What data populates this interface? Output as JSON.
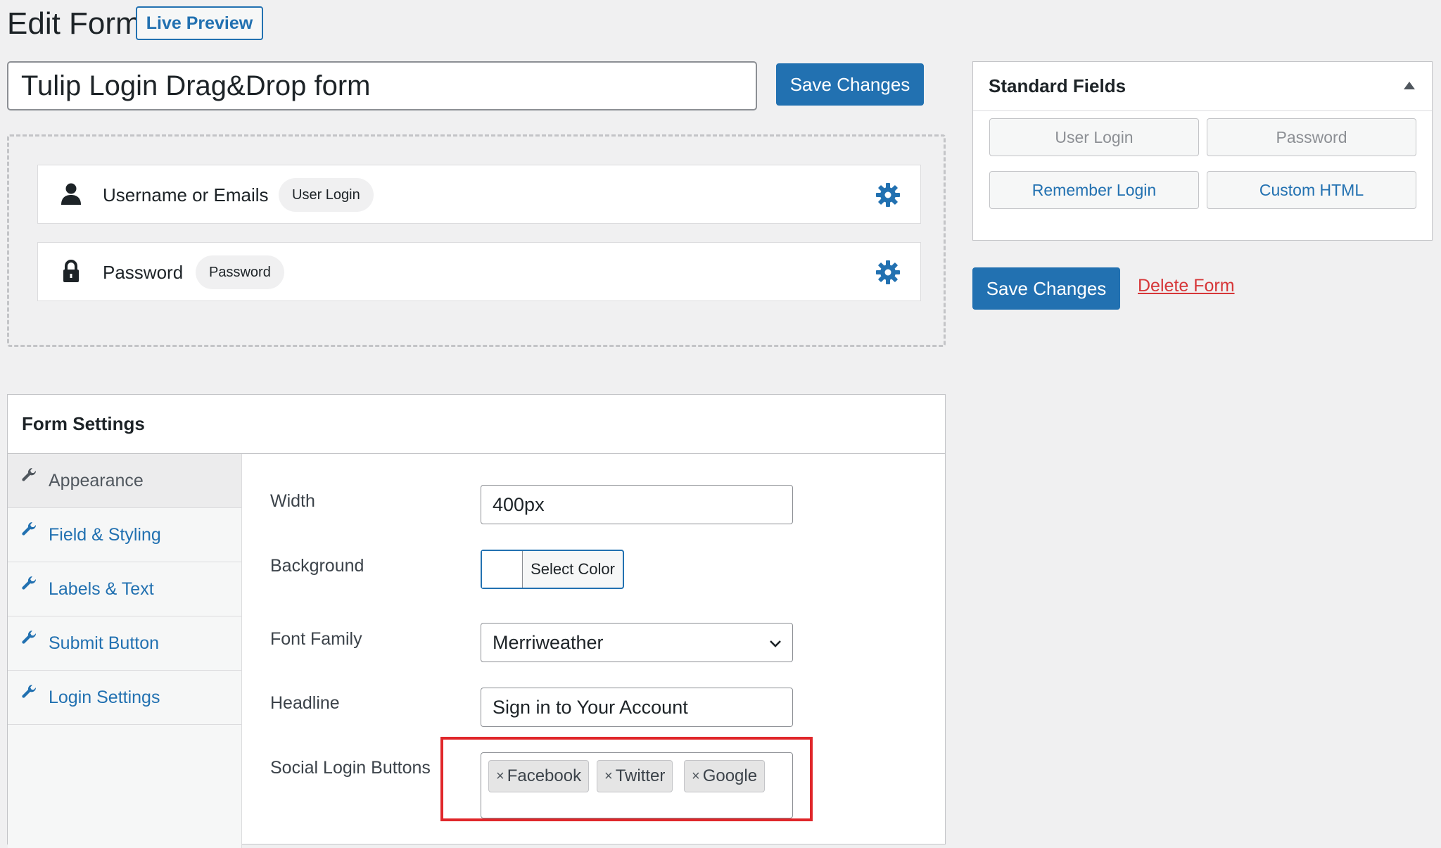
{
  "header": {
    "title": "Edit Form",
    "live_preview_label": "Live Preview"
  },
  "form_title": {
    "value": "Tulip Login Drag&Drop form"
  },
  "toolbar": {
    "save_label": "Save Changes"
  },
  "form_fields": [
    {
      "label": "Username or Emails",
      "tag": "User Login",
      "icon": "user-icon"
    },
    {
      "label": "Password",
      "tag": "Password",
      "icon": "lock-icon"
    }
  ],
  "settings": {
    "title": "Form Settings",
    "nav": [
      {
        "label": "Appearance",
        "active": true
      },
      {
        "label": "Field & Styling",
        "active": false
      },
      {
        "label": "Labels & Text",
        "active": false
      },
      {
        "label": "Submit Button",
        "active": false
      },
      {
        "label": "Login Settings",
        "active": false
      }
    ],
    "width": {
      "label": "Width",
      "value": "400px"
    },
    "background": {
      "label": "Background",
      "button_label": "Select Color"
    },
    "font_family": {
      "label": "Font Family",
      "value": "Merriweather"
    },
    "headline": {
      "label": "Headline",
      "value": "Sign in to Your Account"
    },
    "social_login": {
      "label": "Social Login Buttons",
      "chips": [
        "Facebook",
        "Twitter",
        "Google"
      ]
    }
  },
  "standard_fields": {
    "title": "Standard Fields",
    "buttons": [
      {
        "label": "User Login",
        "enabled": false
      },
      {
        "label": "Password",
        "enabled": false
      },
      {
        "label": "Remember Login",
        "enabled": true
      },
      {
        "label": "Custom HTML",
        "enabled": true
      }
    ]
  },
  "sidebar_actions": {
    "save_label": "Save Changes",
    "delete_label": "Delete Form"
  },
  "colors": {
    "accent": "#2271b1",
    "danger": "#d63638",
    "highlight": "#e0262a"
  }
}
